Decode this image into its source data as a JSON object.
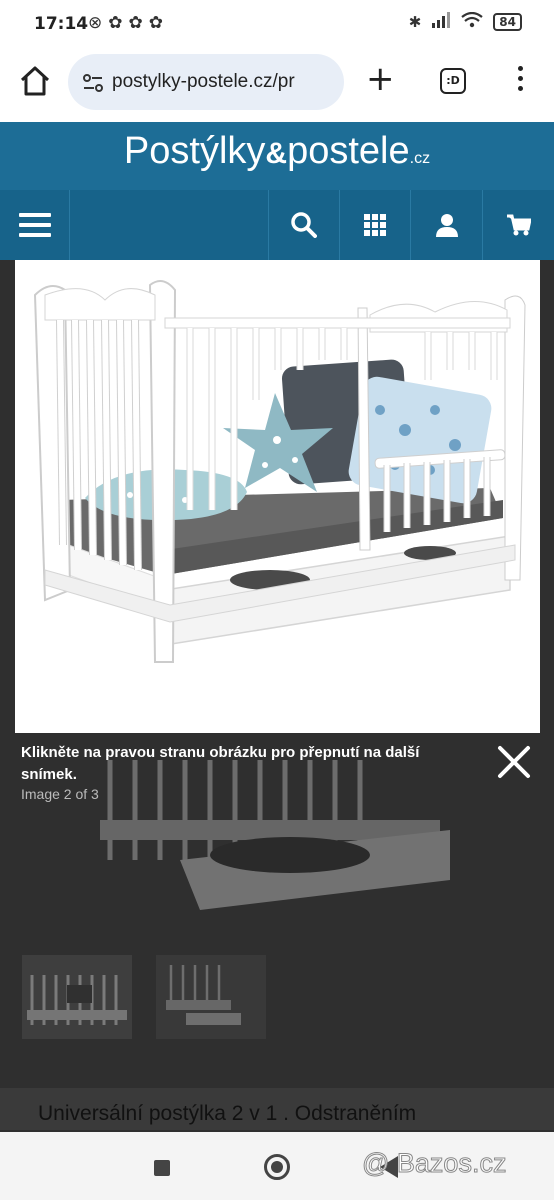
{
  "status_bar": {
    "time": "17:14",
    "notification_icons": "⊗✿✿✿",
    "battery": "84"
  },
  "browser": {
    "url": "postylky-postele.cz/pr",
    "tabs_label": ":D"
  },
  "site": {
    "logo_main": "Postýlky",
    "logo_amp": "&",
    "logo_second": "postele",
    "logo_tld": ".cz",
    "nav_icons": [
      "menu-icon",
      "search-icon",
      "grid-icon",
      "user-icon",
      "cart-icon"
    ],
    "colors": {
      "header": "#1d6d96",
      "nav": "#17638a"
    }
  },
  "lightbox": {
    "caption": "Klikněte na pravou stranu obrázku pro přepnutí na další snímek.",
    "counter": "Image 2 of 3"
  },
  "page": {
    "product_title": "Universální postýlka 2 v 1 . Odstraněním"
  },
  "watermark": "@ Bazos.cz"
}
